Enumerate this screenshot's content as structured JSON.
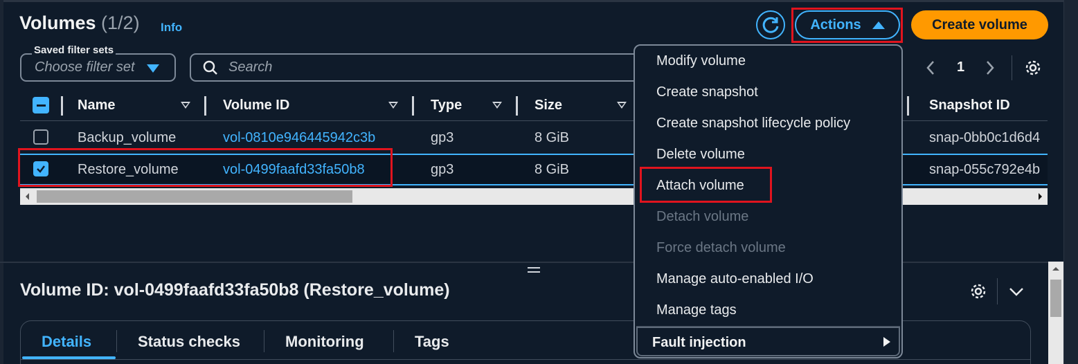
{
  "header": {
    "title": "Volumes",
    "count": "(1/2)",
    "info_label": "Info",
    "actions_label": "Actions",
    "create_label": "Create volume"
  },
  "filters": {
    "saved_label": "Saved filter sets",
    "saved_placeholder": "Choose filter set",
    "search_placeholder": "Search"
  },
  "pagination": {
    "current_page": "1"
  },
  "table": {
    "columns": [
      "Name",
      "Volume ID",
      "Type",
      "Size",
      "Snapshot ID"
    ],
    "rows": [
      {
        "name": "Backup_volume",
        "volume_id": "vol-0810e946445942c3b",
        "type": "gp3",
        "size": "8 GiB",
        "snapshot_id": "snap-0bb0c1d6d4",
        "selected": false
      },
      {
        "name": "Restore_volume",
        "volume_id": "vol-0499faafd33fa50b8",
        "type": "gp3",
        "size": "8 GiB",
        "snapshot_id": "snap-055c792e4b",
        "selected": true
      }
    ]
  },
  "menu": {
    "items": [
      {
        "label": "Modify volume",
        "disabled": false
      },
      {
        "label": "Create snapshot",
        "disabled": false
      },
      {
        "label": "Create snapshot lifecycle policy",
        "disabled": false
      },
      {
        "label": "Delete volume",
        "disabled": false
      },
      {
        "label": "Attach volume",
        "disabled": false
      },
      {
        "label": "Detach volume",
        "disabled": true
      },
      {
        "label": "Force detach volume",
        "disabled": true
      },
      {
        "label": "Manage auto-enabled I/O",
        "disabled": false
      },
      {
        "label": "Manage tags",
        "disabled": false
      }
    ],
    "submenu_label": "Fault injection"
  },
  "details": {
    "title": "Volume ID: vol-0499faafd33fa50b8 (Restore_volume)",
    "tabs": [
      "Details",
      "Status checks",
      "Monitoring",
      "Tags"
    ],
    "active_tab": "Details"
  },
  "colors": {
    "background": "#0f1b2a",
    "accent": "#42b4ff",
    "primary_button": "#ff9900",
    "highlight": "#e0141e"
  },
  "icons": [
    "refresh-icon",
    "caret-up-icon",
    "caret-down-icon",
    "search-icon",
    "chevron-left-icon",
    "chevron-right-icon",
    "gear-icon",
    "chevron-down-icon",
    "sort-icon",
    "checkbox-icon"
  ]
}
